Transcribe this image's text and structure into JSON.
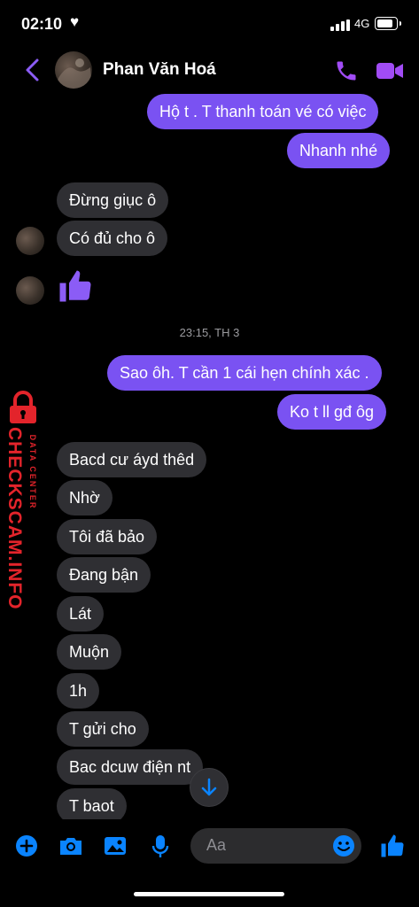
{
  "status_bar": {
    "time": "02:10",
    "network": "4G"
  },
  "header": {
    "contact_name": "Phan Văn Hoá"
  },
  "messages_top": {
    "out_1": "Hộ t . T thanh toán vé có việc",
    "out_2": "Nhanh nhé",
    "in_1": "Đừng giục ô",
    "in_2": "Có đủ cho ô"
  },
  "timestamp": "23:15, TH 3",
  "messages_mid": {
    "out_3": "Sao ôh. T cần 1 cái hẹn chính xác .",
    "out_4": "Ko t ll gđ ôg"
  },
  "messages_bottom": [
    "Bacd cư áyd thêd",
    "Nhờ",
    "Tôi đã bảo",
    "Đang bận",
    "Lát",
    "Muộn",
    "1h",
    "T gửi cho",
    "Bac dcuw điện nt",
    "T baot"
  ],
  "watermark": {
    "brand": "CHECKSCAM.INFO",
    "subtitle": "DATA CENTER"
  },
  "composer": {
    "placeholder": "Aa"
  },
  "colors": {
    "accent": "#7a52f2",
    "incoming": "#2f2f33",
    "icon_blue": "#0a84ff",
    "watermark": "#e3242b"
  }
}
